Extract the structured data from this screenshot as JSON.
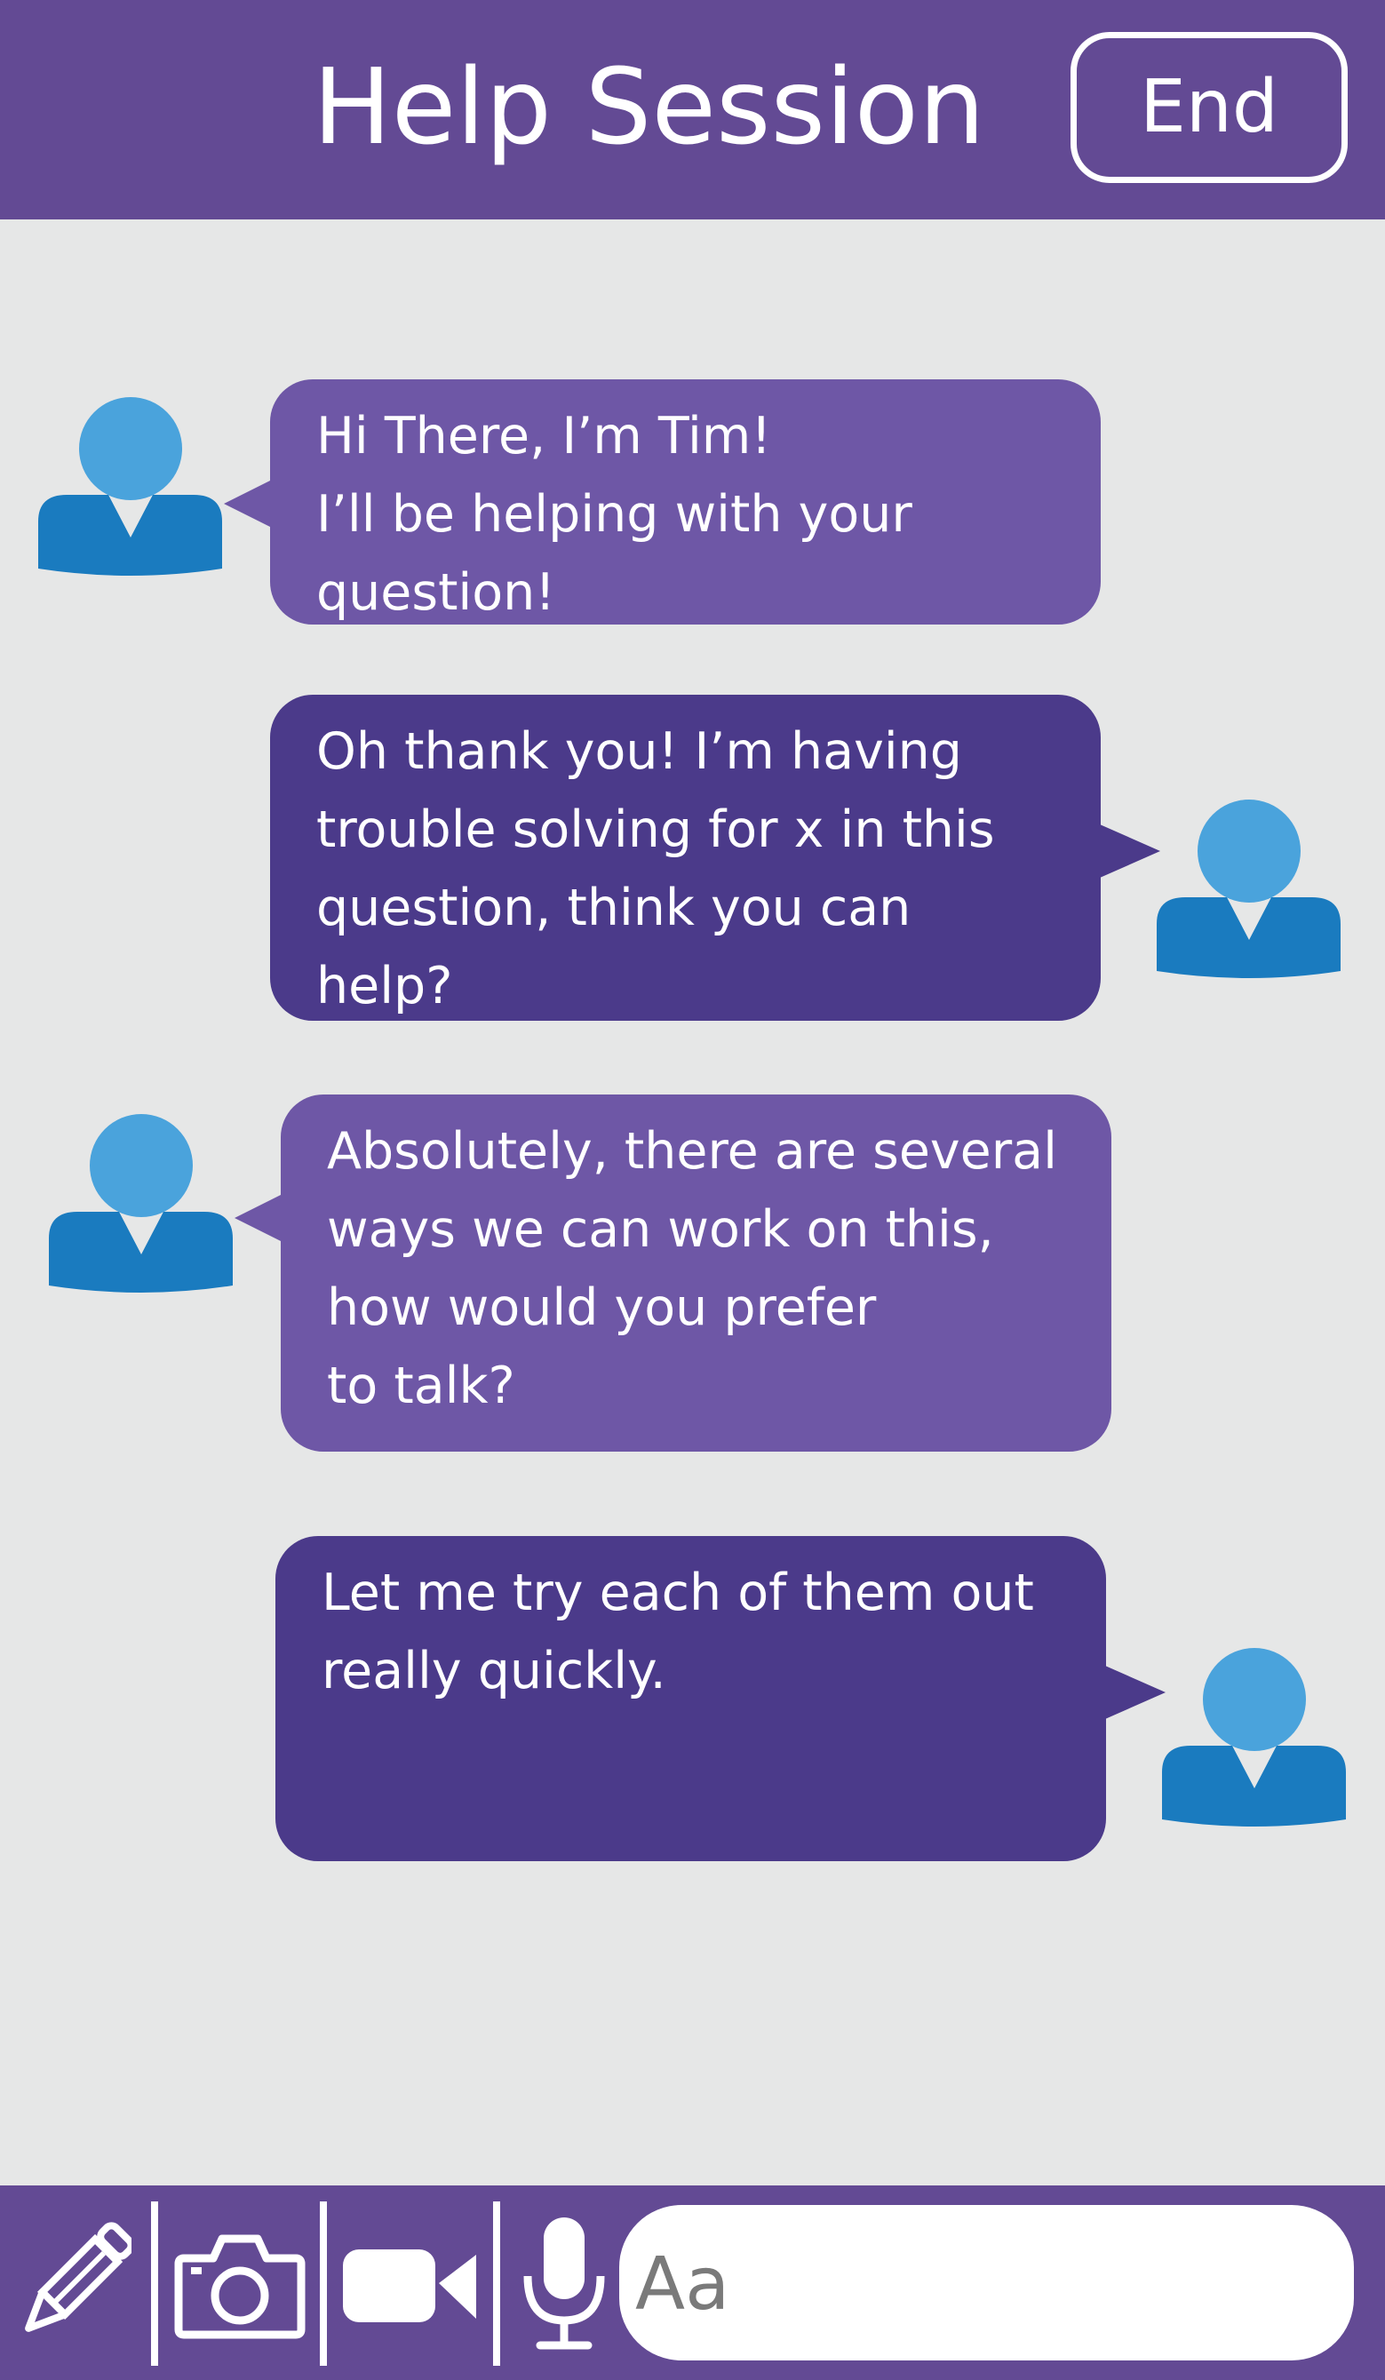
{
  "header": {
    "title": "Help Session",
    "end_label": "End"
  },
  "messages": [
    {
      "sender": "tutor",
      "text": "Hi There, I’m Tim!\nI’ll be helping with your\nquestion!"
    },
    {
      "sender": "student",
      "text": "Oh thank you! I’m having\ntrouble solving for x in this\nquestion, think you can\nhelp?"
    },
    {
      "sender": "tutor",
      "text": "Absolutely, there are several\nways we can work on this,\nhow would you prefer\nto talk?"
    },
    {
      "sender": "student",
      "text": "Let me try each of them out\nreally quickly."
    }
  ],
  "footer": {
    "tools": [
      "pencil-icon",
      "camera-icon",
      "video-icon",
      "microphone-icon"
    ],
    "input_placeholder": "Aa"
  },
  "colors": {
    "bar": "#634a94",
    "tutor_bubble": "#6e57a6",
    "student_bubble": "#4b3a8a",
    "avatar_head": "#4aa3dc",
    "avatar_body": "#1a7bbf",
    "background": "#e6e7e7"
  }
}
